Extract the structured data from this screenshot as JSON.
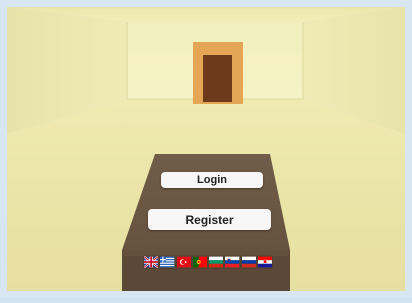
{
  "login": {
    "label": "Login"
  },
  "register": {
    "label": "Register"
  },
  "languages": [
    "english",
    "greek",
    "turkish",
    "portuguese",
    "bulgarian",
    "slovenian",
    "russian",
    "croatian"
  ],
  "colors": {
    "wall": "#ecebb6",
    "floor": "#e8e3a6",
    "door": "#6b3a1c",
    "door_frame": "#e2a250",
    "pedestal": "#6b5744",
    "frame": "#d7e6f1"
  }
}
